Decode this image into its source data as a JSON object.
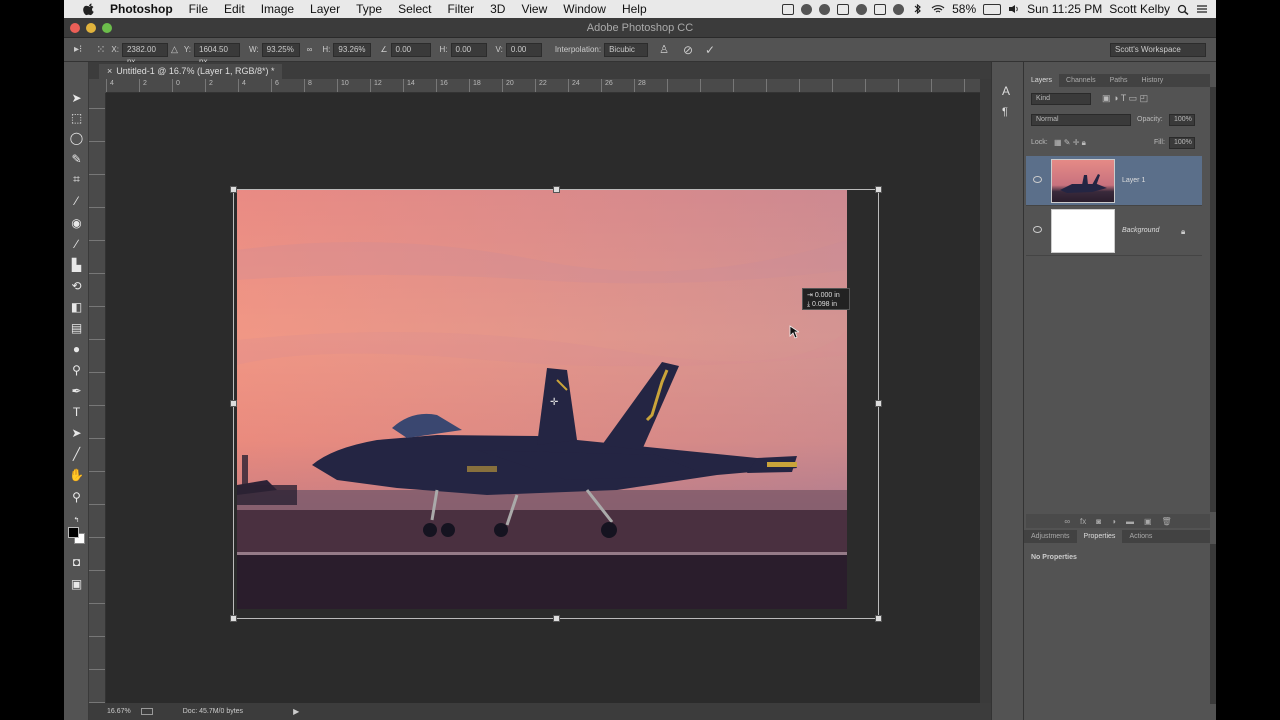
{
  "menubar": {
    "app": "Photoshop",
    "items": [
      "File",
      "Edit",
      "Image",
      "Layer",
      "Type",
      "Select",
      "Filter",
      "3D",
      "View",
      "Window",
      "Help"
    ],
    "battery": "58%",
    "clock": "Sun 11:25 PM",
    "user": "Scott Kelby"
  },
  "window": {
    "title": "Adobe Photoshop CC"
  },
  "options": {
    "x": "2382.00 px",
    "y": "1604.50 px",
    "w_label": "W:",
    "w": "93.25%",
    "h_label": "H:",
    "h": "93.26%",
    "angle": "0.00",
    "hskew": "0.00",
    "vskew": "0.00",
    "interp_label": "Interpolation:",
    "interp": "Bicubic",
    "workspace": "Scott's Workspace"
  },
  "document": {
    "tab": "Untitled-1 @ 16.7% (Layer 1, RGB/8*) *"
  },
  "ruler_ticks": [
    "4",
    "2",
    "0",
    "2",
    "4",
    "6",
    "8",
    "10",
    "12",
    "14",
    "16",
    "18",
    "20",
    "22",
    "24",
    "26",
    "28"
  ],
  "transform_tip": {
    "dx": "0.000 in",
    "dy": "0.098 in"
  },
  "status": {
    "zoom": "16.67%",
    "doc": "Doc: 45.7M/0 bytes"
  },
  "layers_panel": {
    "tabs": [
      "Layers",
      "Channels",
      "Paths",
      "History"
    ],
    "kind": "Kind",
    "blend": "Normal",
    "opacity_label": "Opacity:",
    "opacity": "100%",
    "lock_label": "Lock:",
    "fill_label": "Fill:",
    "fill": "100%",
    "layers": [
      {
        "name": "Layer 1",
        "selected": true
      },
      {
        "name": "Background",
        "locked": true
      }
    ]
  },
  "properties_panel": {
    "tabs": [
      "Adjustments",
      "Properties",
      "Actions"
    ],
    "message": "No Properties"
  },
  "colors": {
    "ui_dark": "#535353",
    "selection": "#5b6f8a",
    "canvas": "#2b2b2b"
  }
}
